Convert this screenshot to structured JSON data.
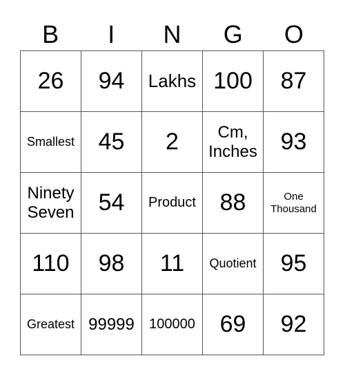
{
  "header": {
    "letters": [
      "B",
      "I",
      "N",
      "G",
      "O"
    ]
  },
  "grid": {
    "rows": [
      [
        "26",
        "94",
        "Lakhs",
        "100",
        "87"
      ],
      [
        "Smallest",
        "45",
        "2",
        "Cm, Inches",
        "93"
      ],
      [
        "Ninety Seven",
        "54",
        "Product",
        "88",
        "One Thousand"
      ],
      [
        "110",
        "98",
        "11",
        "Quotient",
        "95"
      ],
      [
        "Greatest",
        "99999",
        "100000",
        "69",
        "92"
      ]
    ]
  }
}
